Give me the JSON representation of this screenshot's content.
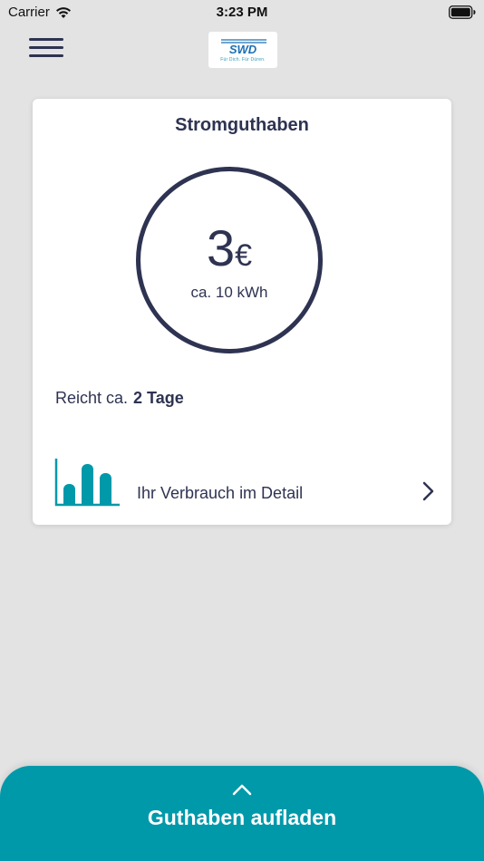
{
  "status_bar": {
    "carrier": "Carrier",
    "time": "3:23 PM"
  },
  "header": {
    "logo_text": "SWD",
    "logo_tagline": "Für Dich. Für Düren."
  },
  "card": {
    "title": "Stromguthaben",
    "balance_value": "3",
    "balance_currency": "€",
    "energy": "ca. 10 kWh",
    "duration_label": "Reicht ca.",
    "duration_value": "2 Tage",
    "detail_link": "Ihr Verbrauch im Detail"
  },
  "bottom_sheet": {
    "label": "Guthaben aufladen"
  },
  "colors": {
    "accent": "#0099aa",
    "text": "#2e3352",
    "background": "#e3e3e3"
  }
}
